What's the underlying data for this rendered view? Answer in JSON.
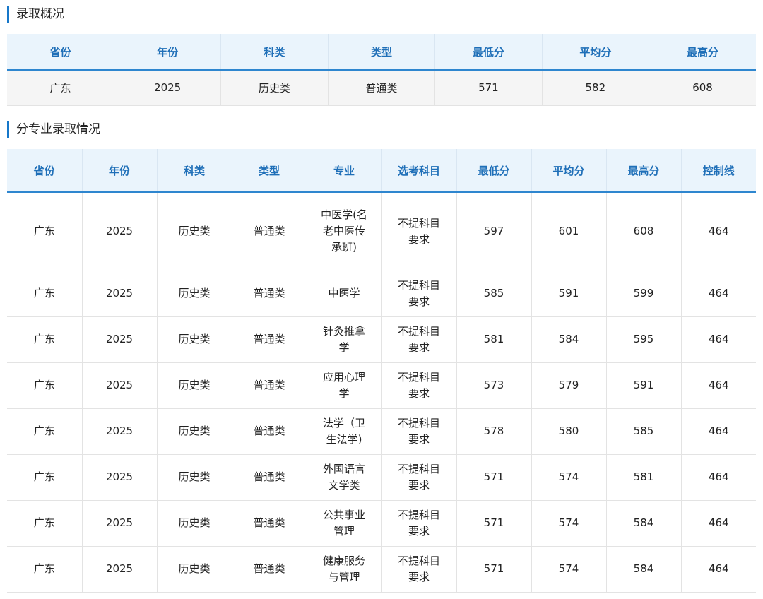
{
  "summary": {
    "title": "录取概况",
    "headers": [
      "省份",
      "年份",
      "科类",
      "类型",
      "最低分",
      "平均分",
      "最高分"
    ],
    "row": [
      "广东",
      "2025",
      "历史类",
      "普通类",
      "571",
      "582",
      "608"
    ]
  },
  "majors": {
    "title": "分专业录取情况",
    "headers": [
      "省份",
      "年份",
      "科类",
      "类型",
      "专业",
      "选考科目",
      "最低分",
      "平均分",
      "最高分",
      "控制线"
    ],
    "rows": [
      [
        "广东",
        "2025",
        "历史类",
        "普通类",
        "中医学(名老中医传承班)",
        "不提科目要求",
        "597",
        "601",
        "608",
        "464"
      ],
      [
        "广东",
        "2025",
        "历史类",
        "普通类",
        "中医学",
        "不提科目要求",
        "585",
        "591",
        "599",
        "464"
      ],
      [
        "广东",
        "2025",
        "历史类",
        "普通类",
        "针灸推拿学",
        "不提科目要求",
        "581",
        "584",
        "595",
        "464"
      ],
      [
        "广东",
        "2025",
        "历史类",
        "普通类",
        "应用心理学",
        "不提科目要求",
        "573",
        "579",
        "591",
        "464"
      ],
      [
        "广东",
        "2025",
        "历史类",
        "普通类",
        "法学（卫生法学)",
        "不提科目要求",
        "578",
        "580",
        "585",
        "464"
      ],
      [
        "广东",
        "2025",
        "历史类",
        "普通类",
        "外国语言文学类",
        "不提科目要求",
        "571",
        "574",
        "581",
        "464"
      ],
      [
        "广东",
        "2025",
        "历史类",
        "普通类",
        "公共事业管理",
        "不提科目要求",
        "571",
        "574",
        "584",
        "464"
      ],
      [
        "广东",
        "2025",
        "历史类",
        "普通类",
        "健康服务与管理",
        "不提科目要求",
        "571",
        "574",
        "584",
        "464"
      ]
    ]
  },
  "colors": {
    "accent": "#1677c9",
    "header_bg": "#eaf4fc",
    "header_text": "#1f6fb8",
    "summary_row_bg": "#f5f5f5"
  }
}
